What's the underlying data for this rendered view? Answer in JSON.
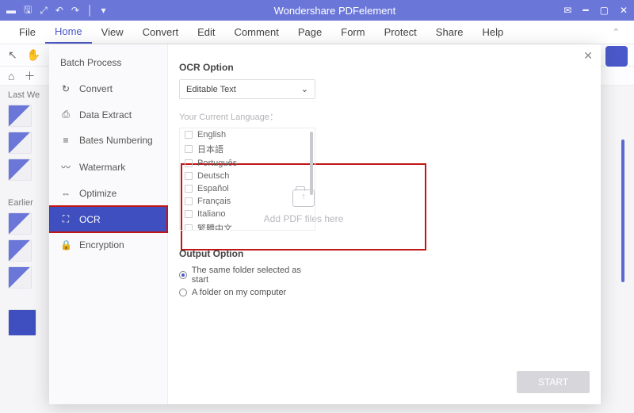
{
  "titlebar": {
    "title": "Wondershare PDFelement"
  },
  "menu": {
    "items": [
      "File",
      "Home",
      "View",
      "Convert",
      "Edit",
      "Comment",
      "Page",
      "Form",
      "Protect",
      "Share",
      "Help"
    ],
    "active": 1
  },
  "history": {
    "last_label": "Last We",
    "earlier_label": "Earlier"
  },
  "modal": {
    "header": "Batch Process",
    "side": [
      {
        "label": "Convert",
        "icon": "↻"
      },
      {
        "label": "Data Extract",
        "icon": "⎙"
      },
      {
        "label": "Bates Numbering",
        "icon": "≡"
      },
      {
        "label": "Watermark",
        "icon": "〰"
      },
      {
        "label": "Optimize",
        "icon": "⇔"
      },
      {
        "label": "OCR",
        "icon": "⛶"
      },
      {
        "label": "Encryption",
        "icon": "🔒"
      }
    ],
    "selected": 5,
    "drop_text": "Add PDF files here",
    "ocr": {
      "section": "OCR Option",
      "select_value": "Editable Text",
      "lang_label": "Your Current Language：",
      "languages": [
        "English",
        "日本語",
        "Português",
        "Deutsch",
        "Español",
        "Français",
        "Italiano",
        "繁體中文"
      ]
    },
    "output": {
      "section": "Output Option",
      "opt1": "The same folder selected as start",
      "opt2": "A folder on my computer"
    },
    "start": "START"
  }
}
